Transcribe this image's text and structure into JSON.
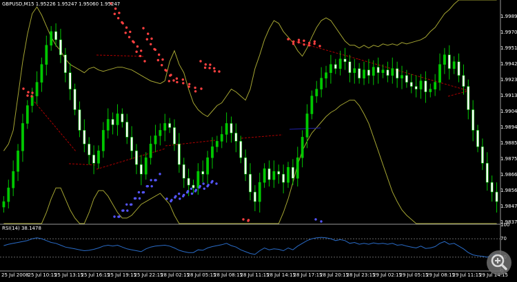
{
  "window": {
    "symbol_caption": "GBPUSD,M15  1.95226 1.95247 1.95060 1.95247",
    "indicator_caption": "RSI(14) 38.1478"
  },
  "colors": {
    "background": "#000000",
    "bull_candle": "#00c800",
    "bear_candle": "#ffffff",
    "wick": "#00c800",
    "band": "#a5a532",
    "trend": "#b00000",
    "flat": "#2222aa",
    "arrow_up": "#5555ff",
    "arrow_down": "#ff4040",
    "rsi_line": "#2a6cc8",
    "axis_text": "#ffffff"
  },
  "chart_data": [
    {
      "type": "line",
      "title": "",
      "price_axis_labels": [
        "1.99890",
        "1.99705",
        "1.99510",
        "1.99420",
        "1.99230",
        "1.99135",
        "1.99040",
        "1.98945",
        "1.98850",
        "1.98755",
        "1.98660",
        "1.98565",
        "1.98470",
        "1.98375"
      ],
      "time_axis_labels": [
        "25 Jul 2008",
        "25 Jul 10:15",
        "25 Jul 13:15",
        "25 Jul 16:15",
        "25 Jul 19:15",
        "25 Jul 22:15",
        "28 Jul 02:15",
        "28 Jul 05:15",
        "28 Jul 08:15",
        "28 Jul 11:15",
        "28 Jul 14:15",
        "28 Jul 17:15",
        "28 Jul 20:15",
        "28 Jul 23:15",
        "29 Jul 02:15",
        "29 Jul 05:15",
        "29 Jul 08:15",
        "29 Jul 11:15",
        "29 Jul 14:15"
      ],
      "ylim": [
        1.9832,
        1.9995
      ],
      "close": [
        1.9848,
        1.9858,
        1.987,
        1.9885,
        1.9905,
        1.9918,
        1.9925,
        1.9935,
        1.9948,
        1.9962,
        1.9972,
        1.9966,
        1.9955,
        1.9942,
        1.993,
        1.9915,
        1.99,
        1.989,
        1.9882,
        1.9876,
        1.9885,
        1.99,
        1.9908,
        1.9904,
        1.9912,
        1.9906,
        1.9895,
        1.9885,
        1.9875,
        1.9868,
        1.988,
        1.989,
        1.9896,
        1.99,
        1.9905,
        1.9902,
        1.989,
        1.9875,
        1.9865,
        1.986,
        1.9858,
        1.987,
        1.9868,
        1.988,
        1.9888,
        1.9892,
        1.9897,
        1.9905,
        1.9898,
        1.9892,
        1.988,
        1.9868,
        1.9855,
        1.9848,
        1.9862,
        1.9872,
        1.9864,
        1.987,
        1.9868,
        1.9862,
        1.9873,
        1.9865,
        1.988,
        1.9895,
        1.9912,
        1.9925,
        1.993,
        1.9938,
        1.9942,
        1.9948,
        1.9945,
        1.9952,
        1.995,
        1.9942,
        1.9945,
        1.9938,
        1.9944,
        1.994,
        1.9946,
        1.9942,
        1.9944,
        1.994,
        1.9945,
        1.9938,
        1.994,
        1.9935,
        1.9932,
        1.993,
        1.9936,
        1.9928,
        1.993,
        1.9935,
        1.9948,
        1.9955,
        1.9945,
        1.995,
        1.994,
        1.9932,
        1.9915,
        1.99,
        1.9888,
        1.9876,
        1.9862,
        1.9855,
        1.9848
      ],
      "bb_upper": [
        1.9885,
        1.989,
        1.99,
        1.9925,
        1.995,
        1.997,
        1.9985,
        1.999,
        1.9984,
        1.9976,
        1.9968,
        1.9962,
        1.9958,
        1.9952,
        1.9948,
        1.9946,
        1.9944,
        1.9942,
        1.9945,
        1.9946,
        1.9944,
        1.9943,
        1.9944,
        1.9945,
        1.9946,
        1.9946,
        1.9945,
        1.9944,
        1.9942,
        1.994,
        1.9938,
        1.9936,
        1.9935,
        1.9934,
        1.9936,
        1.995,
        1.9958,
        1.9948,
        1.9942,
        1.993,
        1.992,
        1.9915,
        1.9912,
        1.991,
        1.9914,
        1.9918,
        1.992,
        1.9925,
        1.993,
        1.9928,
        1.9925,
        1.9922,
        1.993,
        1.9945,
        1.9955,
        1.9966,
        1.9974,
        1.998,
        1.9978,
        1.9972,
        1.9968,
        1.9964,
        1.9958,
        1.9954,
        1.996,
        1.9968,
        1.9975,
        1.998,
        1.9982,
        1.998,
        1.9975,
        1.997,
        1.9965,
        1.9962,
        1.9962,
        1.996,
        1.9962,
        1.996,
        1.9962,
        1.9961,
        1.9963,
        1.9962,
        1.9963,
        1.9962,
        1.9964,
        1.9963,
        1.9964,
        1.9965,
        1.9966,
        1.9968,
        1.9972,
        1.9975,
        1.998,
        1.9985,
        1.9988,
        1.9992,
        1.9995,
        1.9995,
        1.9995,
        1.9995,
        1.9995,
        1.9995,
        1.9995,
        1.9995,
        1.9995
      ],
      "bb_lower": [
        1.9832,
        1.9832,
        1.9832,
        1.9832,
        1.9832,
        1.9832,
        1.9832,
        1.9832,
        1.9832,
        1.984,
        1.985,
        1.9858,
        1.9858,
        1.985,
        1.9842,
        1.9836,
        1.9832,
        1.9832,
        1.984,
        1.985,
        1.9856,
        1.9856,
        1.9852,
        1.9846,
        1.984,
        1.9836,
        1.9836,
        1.9838,
        1.9842,
        1.9846,
        1.9848,
        1.985,
        1.9852,
        1.9854,
        1.985,
        1.9846,
        1.9838,
        1.9832,
        1.9832,
        1.9832,
        1.9832,
        1.9832,
        1.9832,
        1.9832,
        1.9832,
        1.9832,
        1.9832,
        1.9832,
        1.9832,
        1.9832,
        1.9832,
        1.9832,
        1.9832,
        1.9832,
        1.9832,
        1.9832,
        1.9832,
        1.9832,
        1.9832,
        1.984,
        1.985,
        1.9862,
        1.9875,
        1.9885,
        1.9892,
        1.9898,
        1.9902,
        1.9906,
        1.991,
        1.9913,
        1.9915,
        1.9918,
        1.992,
        1.9922,
        1.9922,
        1.9918,
        1.9912,
        1.9905,
        1.9895,
        1.9885,
        1.9875,
        1.9865,
        1.9855,
        1.9848,
        1.9842,
        1.9838,
        1.9835,
        1.9832,
        1.9832,
        1.9832,
        1.9832,
        1.9832,
        1.9832,
        1.9832,
        1.9832,
        1.9832,
        1.9832,
        1.9832,
        1.9832,
        1.9832,
        1.9832,
        1.9832,
        1.9832,
        1.9832,
        1.9832
      ]
    },
    {
      "type": "line",
      "title": "RSI(14) 38.1478",
      "levels": [
        100,
        70,
        30,
        0
      ],
      "ylim": [
        0,
        100
      ],
      "values": [
        55,
        58,
        60,
        62,
        64,
        66,
        70,
        72,
        70,
        66,
        62,
        60,
        56,
        52,
        50,
        48,
        46,
        44,
        45,
        47,
        50,
        54,
        56,
        54,
        56,
        52,
        48,
        46,
        44,
        42,
        48,
        52,
        54,
        55,
        56,
        54,
        50,
        45,
        42,
        40,
        40,
        46,
        45,
        50,
        53,
        55,
        57,
        60,
        55,
        52,
        46,
        42,
        38,
        36,
        44,
        50,
        46,
        48,
        47,
        44,
        50,
        46,
        54,
        60,
        66,
        70,
        72,
        73,
        72,
        70,
        66,
        68,
        66,
        60,
        62,
        58,
        60,
        58,
        61,
        59,
        60,
        58,
        60,
        56,
        57,
        54,
        52,
        50,
        54,
        49,
        50,
        53,
        60,
        64,
        58,
        60,
        54,
        48,
        40,
        35,
        33,
        32,
        30,
        34,
        38
      ]
    }
  ]
}
